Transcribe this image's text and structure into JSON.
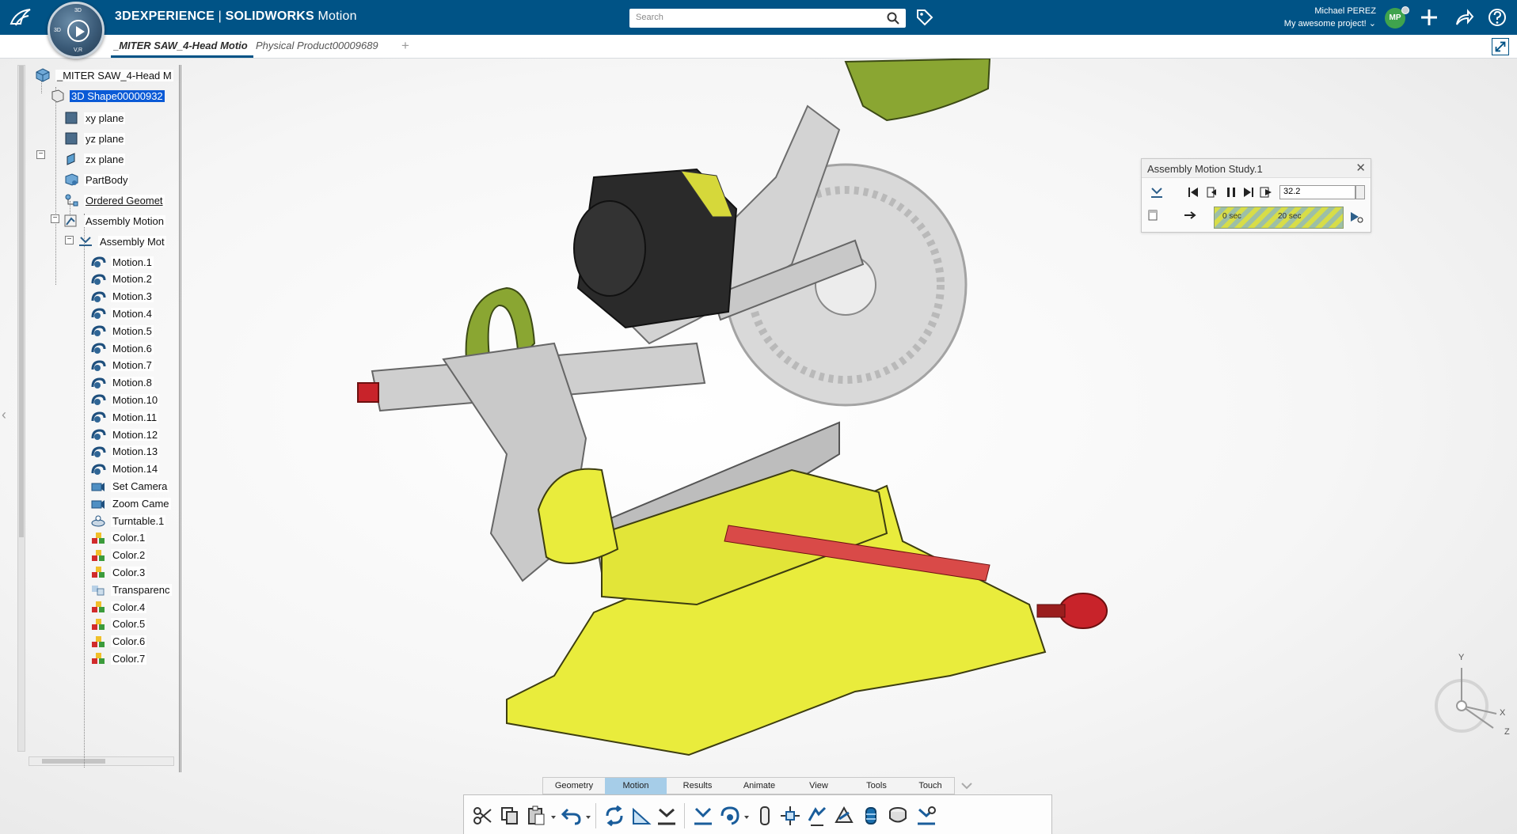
{
  "header": {
    "brand": "3DEXPERIENCE",
    "separator": " | ",
    "product": "SOLIDWORKS",
    "module": " Motion",
    "compass_top": "3D",
    "compass_left": "3D",
    "compass_bottom": "V,R",
    "search_placeholder": "Search",
    "user_name": "Michael PEREZ",
    "project": "My awesome project!",
    "avatar_initials": "MP",
    "icons": [
      "3ds-logo-icon",
      "compass-icon",
      "search-icon",
      "tag-icon",
      "add-icon",
      "share-icon",
      "help-icon"
    ],
    "colors": {
      "topbar": "#005386",
      "avatar": "#3fa34d",
      "accent": "#0a5ad6"
    }
  },
  "tabs": [
    {
      "label": "_MITER SAW_4-Head Motio",
      "active": true
    },
    {
      "label": "Physical Product00009689",
      "active": false
    }
  ],
  "tree": {
    "root": "_MITER SAW_4-Head M",
    "shape": "3D Shape00000932",
    "children": [
      "xy plane",
      "yz plane",
      "zx plane",
      "PartBody",
      "Ordered Geomet",
      "Assembly Motion"
    ],
    "study": "Assembly Mot",
    "items": [
      "Motion.1",
      "Motion.2",
      "Motion.3",
      "Motion.4",
      "Motion.5",
      "Motion.6",
      "Motion.7",
      "Motion.8",
      "Motion.10",
      "Motion.11",
      "Motion.12",
      "Motion.13",
      "Motion.14",
      "Set Camera",
      "Zoom Came",
      "Turntable.1",
      "Color.1",
      "Color.2",
      "Color.3",
      "Transparenc",
      "Color.4",
      "Color.5",
      "Color.6",
      "Color.7"
    ]
  },
  "motion_panel": {
    "title": "Assembly Motion Study.1",
    "value": "32.2",
    "time_start": "0 sec",
    "time_end": "20 sec"
  },
  "axes": {
    "y": "Y",
    "x": "X",
    "z": "Z"
  },
  "command_tabs": [
    "Geometry",
    "Motion",
    "Results",
    "Animate",
    "View",
    "Tools",
    "Touch"
  ],
  "active_command_tab": "Motion",
  "action_icons": [
    "cut-icon",
    "copy-icon",
    "paste-icon",
    "undo-icon",
    "update-icon",
    "measure-icon",
    "mechanism-icon",
    "motion-study-icon",
    "rotate-motion-icon",
    "joint-icon",
    "explode-icon",
    "drive-icon",
    "camera-icon",
    "color-icon",
    "turntable-icon",
    "motion-settings-icon"
  ]
}
